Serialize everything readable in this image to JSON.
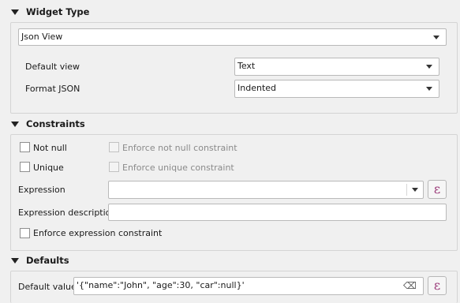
{
  "widget_type": {
    "header": "Widget Type",
    "selected": "Json View",
    "default_view_label": "Default view",
    "default_view_value": "Text",
    "format_json_label": "Format JSON",
    "format_json_value": "Indented"
  },
  "constraints": {
    "header": "Constraints",
    "not_null_label": "Not null",
    "enforce_not_null_label": "Enforce not null constraint",
    "unique_label": "Unique",
    "enforce_unique_label": "Enforce unique constraint",
    "expression_label": "Expression",
    "expression_value": "",
    "expression_description_label": "Expression description",
    "expression_description_value": "",
    "enforce_expression_label": "Enforce expression constraint"
  },
  "defaults": {
    "header": "Defaults",
    "default_value_label": "Default value",
    "default_value": "'{\"name\":\"John\", \"age\":30, \"car\":null}'"
  },
  "icons": {
    "expression_button_glyph": "ε",
    "clear_icon_glyph": "⌫"
  }
}
